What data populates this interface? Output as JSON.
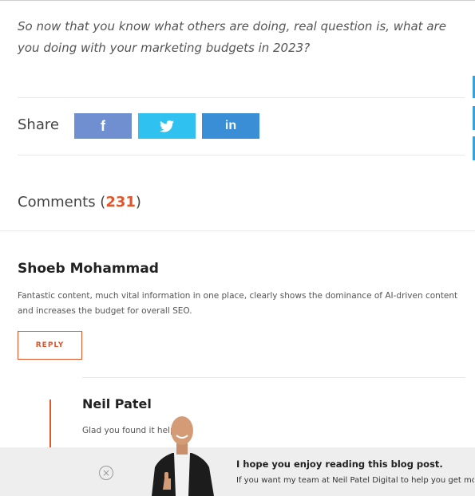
{
  "article": {
    "closing_text": "So now that you know what others are doing, real question is, what are you doing with your marketing budgets in 2023?"
  },
  "share": {
    "label": "Share",
    "buttons": [
      {
        "network": "facebook",
        "glyph": "f",
        "color": "#6f8fd0"
      },
      {
        "network": "twitter",
        "icon": "twitter-bird-icon",
        "color": "#2fc1ef"
      },
      {
        "network": "linkedin",
        "glyph": "in",
        "color": "#3a8ed6"
      }
    ]
  },
  "comments": {
    "title": "Comments (",
    "count": "231",
    "title_end": ")",
    "items": [
      {
        "author": "Shoeb Mohammad",
        "text": "Fantastic content, much vital information in one place, clearly shows the dominance of AI-driven content and increases the budget for overall SEO.",
        "reply_label": "REPLY"
      }
    ],
    "reply": {
      "author": "Neil Patel",
      "text": "Glad you found it helpf"
    }
  },
  "popup": {
    "title": "I hope you enjoy reading this blog post.",
    "subtitle": "If you want my team at Neil Patel Digital to help you get more"
  },
  "colors": {
    "accent": "#e2562c",
    "popup_bg": "#eeeeee"
  }
}
